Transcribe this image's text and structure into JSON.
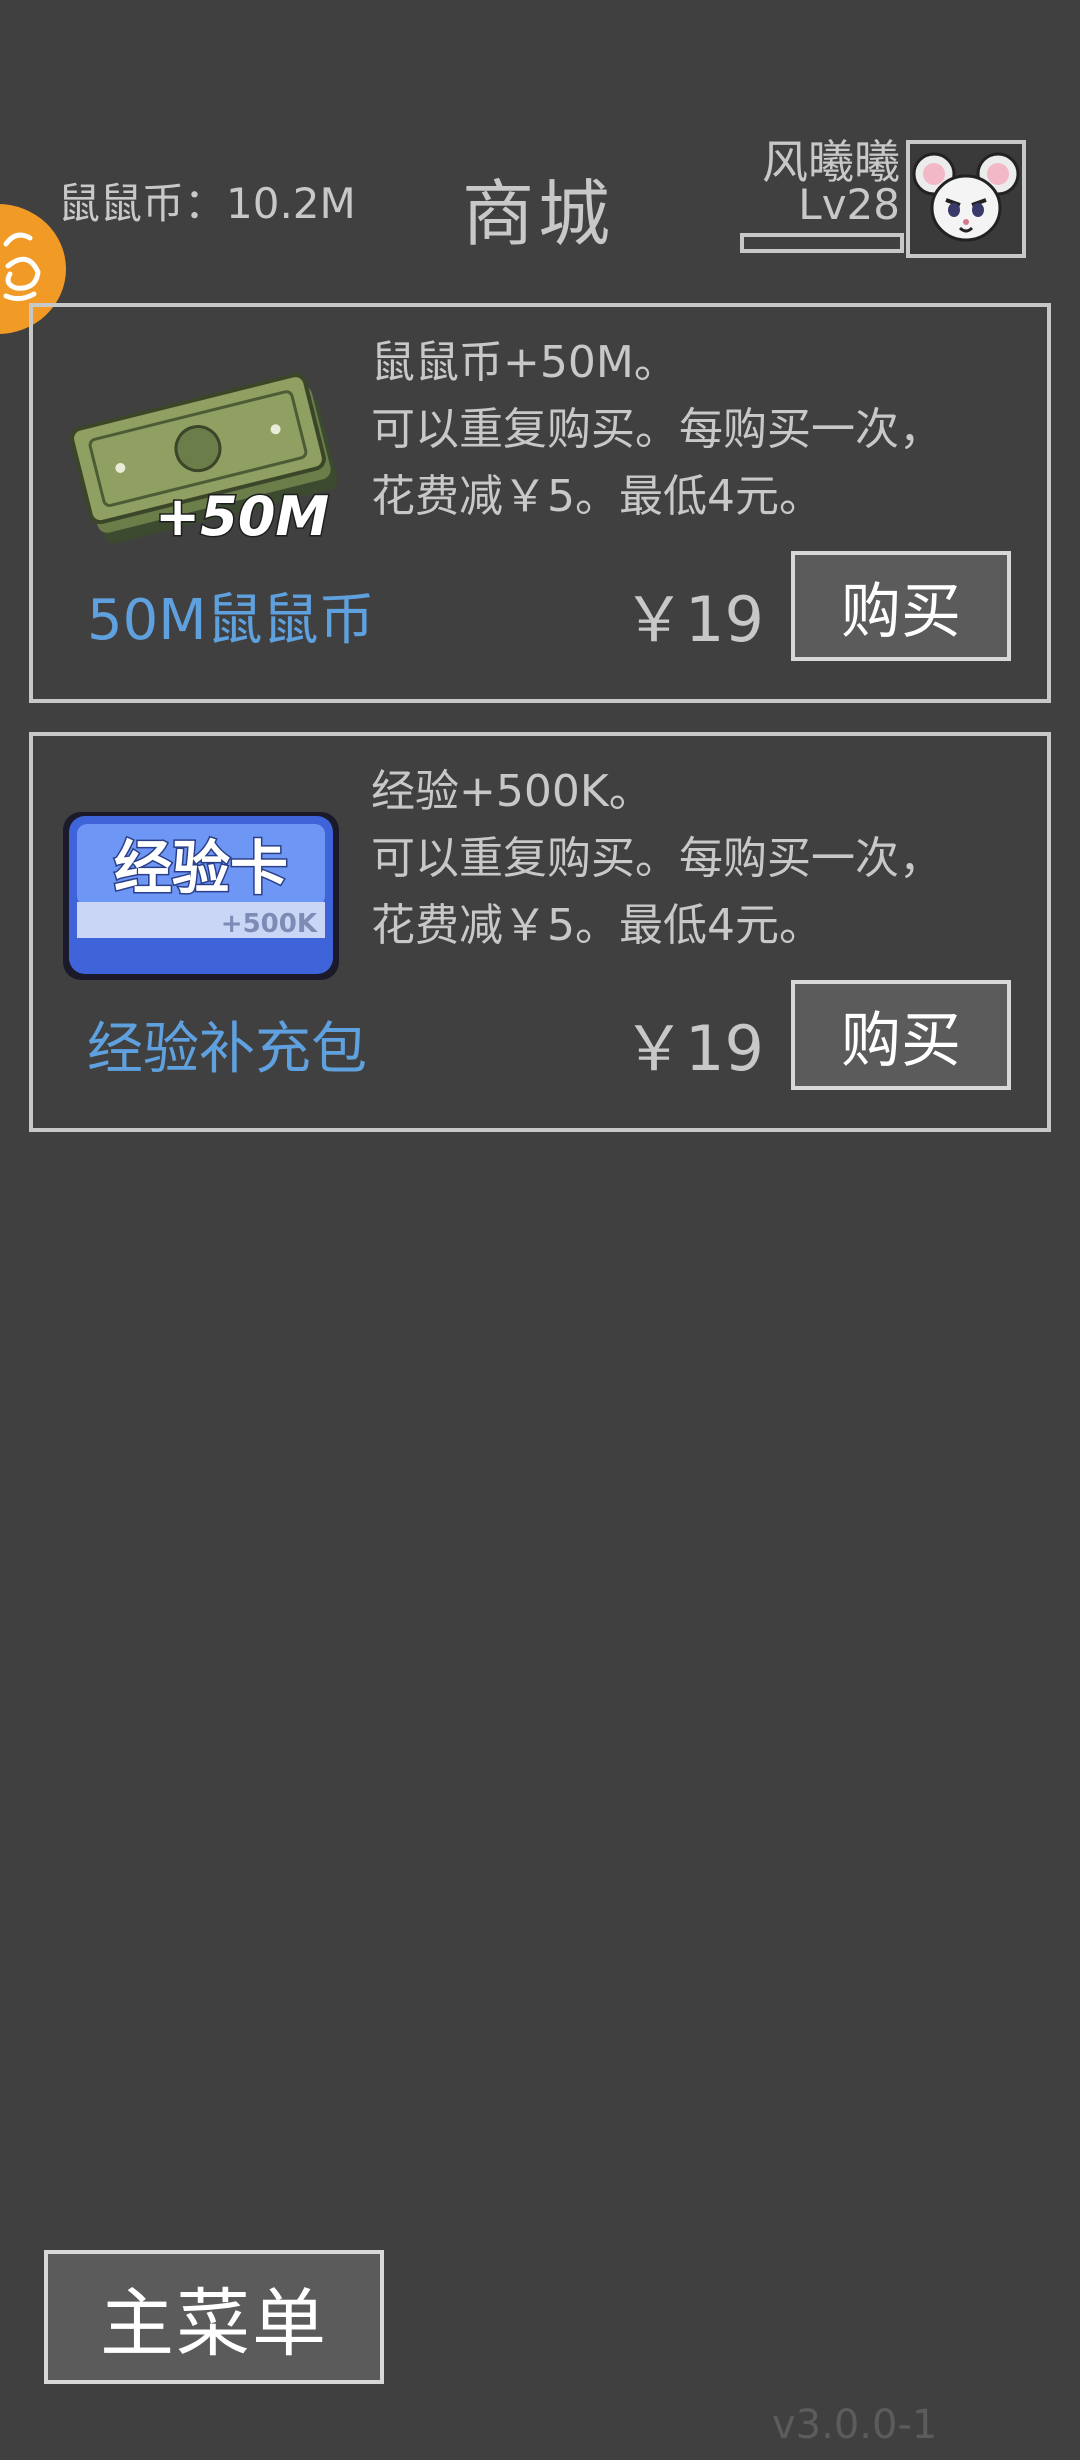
{
  "header": {
    "currency_label": "鼠鼠币：10.2M",
    "title": "商城",
    "user_name": "风曦曦",
    "user_level": "Lv28"
  },
  "items": [
    {
      "name": "50M鼠鼠币",
      "desc_lines": [
        "鼠鼠币+50M。",
        "可以重复购买。每购买一次，",
        "花费减￥5。最低4元。"
      ],
      "price": "￥19",
      "buy_label": "购买",
      "image_label": "+50M",
      "icon": "money-stack-icon"
    },
    {
      "name": "经验补充包",
      "desc_lines": [
        "经验+500K。",
        "可以重复购买。每购买一次，",
        "花费减￥5。最低4元。"
      ],
      "price": "￥19",
      "buy_label": "购买",
      "image_title": "经验卡",
      "image_sub": "+500K",
      "icon": "exp-card-icon"
    }
  ],
  "footer": {
    "main_menu_label": "主菜单",
    "version": "v3.0.0-1"
  },
  "colors": {
    "background": "#404040",
    "text": "#c8c8c8",
    "item_name": "#5fa0de",
    "badge": "#f19a25",
    "button_bg": "#5b5b5b"
  }
}
